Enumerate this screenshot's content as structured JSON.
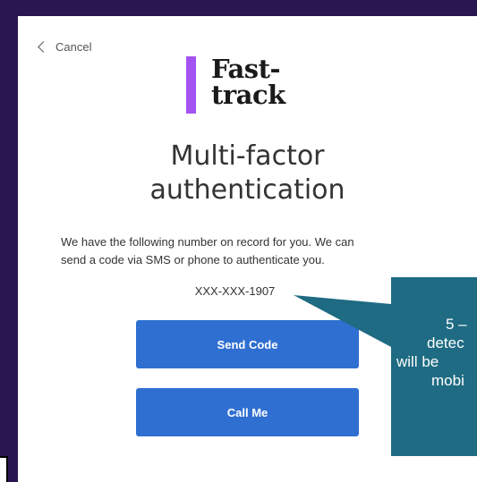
{
  "header": {
    "cancel_label": "Cancel"
  },
  "logo": {
    "line1": "Fast-",
    "line2": "track",
    "accent_color": "#a453f0"
  },
  "title": {
    "line1": "Multi-factor",
    "line2": "authentication"
  },
  "description": {
    "line1": "We have the following number on record for you. We can",
    "line2": "send a code via SMS or phone to authenticate you."
  },
  "phone_number": "XXX-XXX-1907",
  "buttons": {
    "send_code_label": "Send Code",
    "call_me_label": "Call Me",
    "color": "#2f6fd1"
  },
  "callout": {
    "line1": "5 –",
    "line2": "detec",
    "line3": "will be",
    "line4": "mobi",
    "color": "#1e6b83"
  },
  "colors": {
    "frame_border": "#2a1650",
    "text": "#333333"
  }
}
